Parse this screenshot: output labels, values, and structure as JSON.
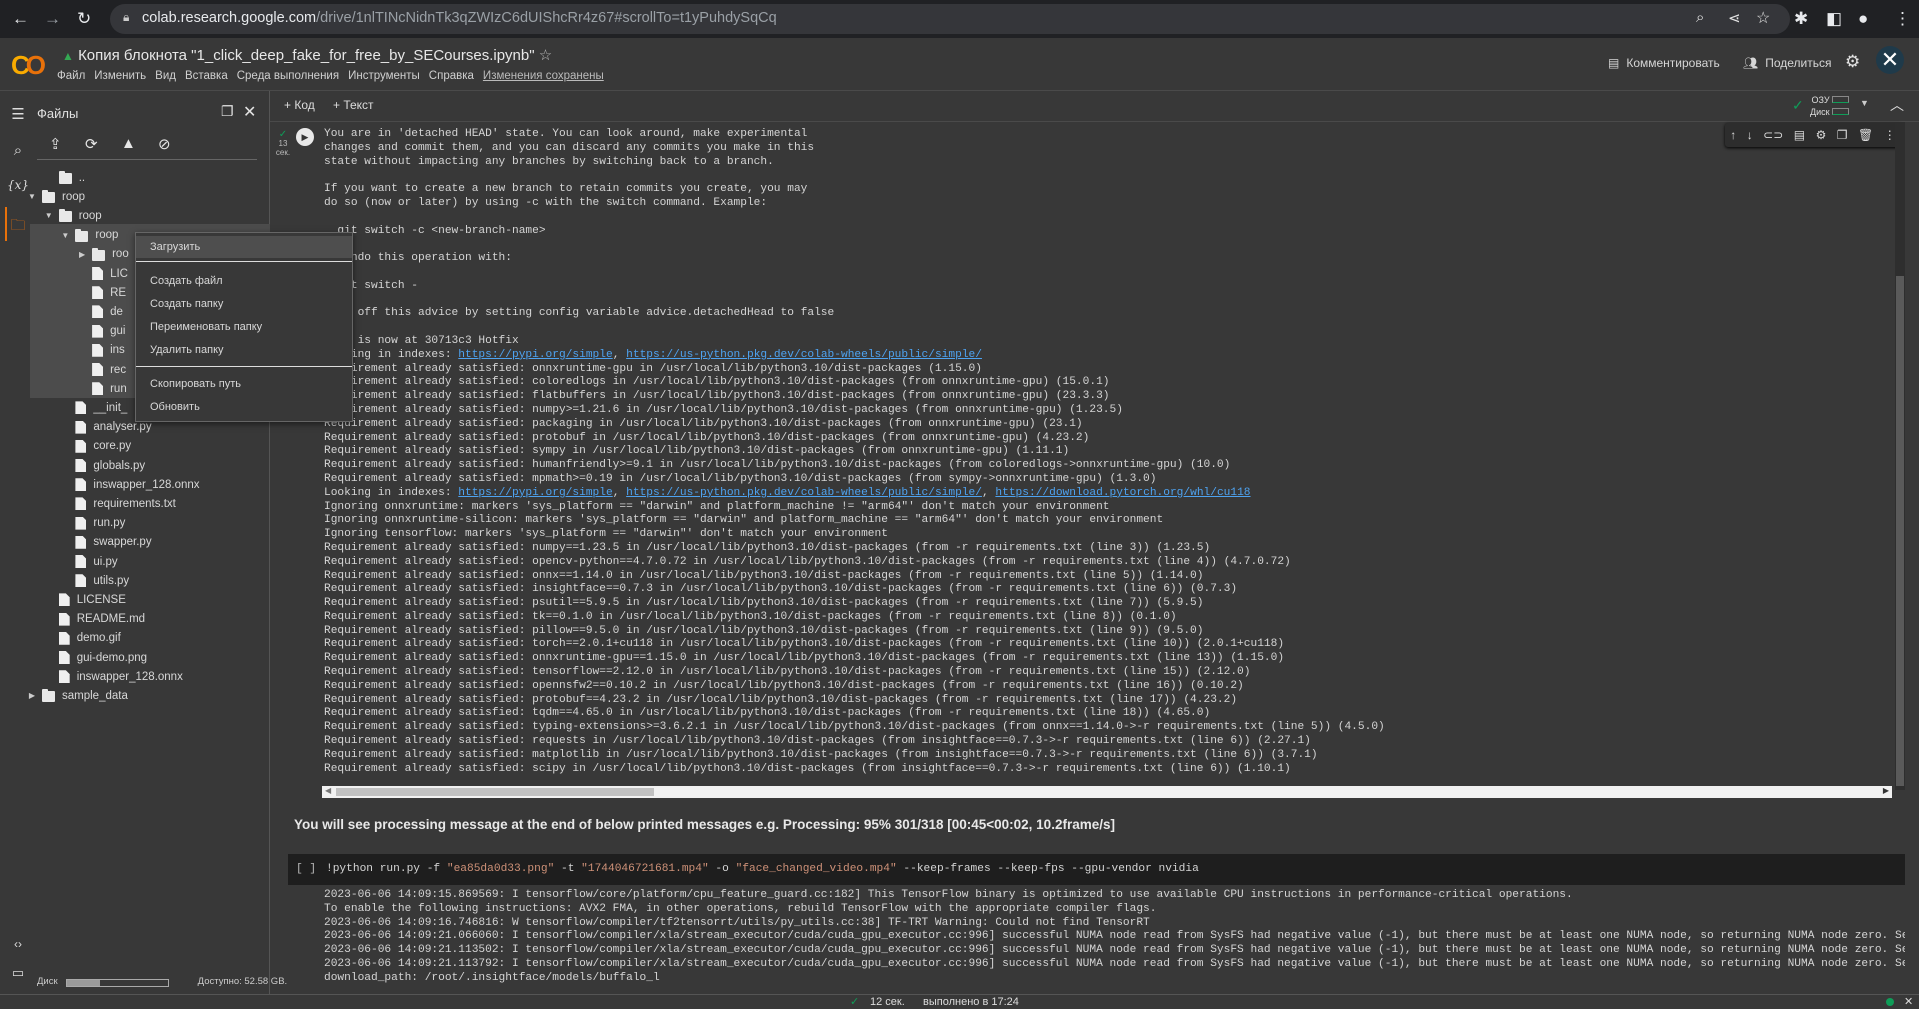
{
  "browser": {
    "url_host": "colab.research.google.com",
    "url_path": "/drive/1nlTINcNidnTk3qZWIzC6dUIShcRr4z67#scrollTo=t1yPuhdySqCq",
    "icons": [
      "back-icon",
      "forward-icon",
      "reload-icon",
      "lock-icon",
      "zoom-icon",
      "share-icon",
      "star-icon",
      "extensions-icon",
      "side-panel-icon",
      "profile-icon",
      "menu-icon"
    ]
  },
  "header": {
    "logo": "CO",
    "title": "Копия блокнота \"1_click_deep_fake_for_free_by_SECourses.ipynb\"",
    "menus": [
      "Файл",
      "Изменить",
      "Вид",
      "Вставка",
      "Среда выполнения",
      "Инструменты",
      "Справка"
    ],
    "saved_status": "Изменения сохранены",
    "comment_label": "Комментировать",
    "share_label": "Поделиться"
  },
  "toolbar": {
    "add_code": "+ Код",
    "add_text": "+ Текст",
    "ram_label": "ОЗУ",
    "disk_label": "Диск"
  },
  "files_panel": {
    "title": "Файлы",
    "tree": [
      {
        "name": "..",
        "level": 1,
        "type": "up"
      },
      {
        "name": "roop",
        "level": 0,
        "type": "folder",
        "expanded": true
      },
      {
        "name": "roop",
        "level": 1,
        "type": "folder",
        "expanded": true
      },
      {
        "name": "roop",
        "level": 2,
        "type": "folder",
        "expanded": true
      },
      {
        "name": "roo",
        "level": 3,
        "type": "folder",
        "expanded": false
      },
      {
        "name": "LIC",
        "level": 3,
        "type": "file"
      },
      {
        "name": "RE",
        "level": 3,
        "type": "file"
      },
      {
        "name": "de",
        "level": 3,
        "type": "file"
      },
      {
        "name": "gui",
        "level": 3,
        "type": "file"
      },
      {
        "name": "ins",
        "level": 3,
        "type": "file"
      },
      {
        "name": "rec",
        "level": 3,
        "type": "file"
      },
      {
        "name": "run",
        "level": 3,
        "type": "file"
      },
      {
        "name": "__init_",
        "level": 2,
        "type": "file"
      },
      {
        "name": "analyser.py",
        "level": 2,
        "type": "file"
      },
      {
        "name": "core.py",
        "level": 2,
        "type": "file"
      },
      {
        "name": "globals.py",
        "level": 2,
        "type": "file"
      },
      {
        "name": "inswapper_128.onnx",
        "level": 2,
        "type": "file"
      },
      {
        "name": "requirements.txt",
        "level": 2,
        "type": "file"
      },
      {
        "name": "run.py",
        "level": 2,
        "type": "file"
      },
      {
        "name": "swapper.py",
        "level": 2,
        "type": "file"
      },
      {
        "name": "ui.py",
        "level": 2,
        "type": "file"
      },
      {
        "name": "utils.py",
        "level": 2,
        "type": "file"
      },
      {
        "name": "LICENSE",
        "level": 1,
        "type": "file"
      },
      {
        "name": "README.md",
        "level": 1,
        "type": "file"
      },
      {
        "name": "demo.gif",
        "level": 1,
        "type": "file"
      },
      {
        "name": "gui-demo.png",
        "level": 1,
        "type": "file"
      },
      {
        "name": "inswapper_128.onnx",
        "level": 1,
        "type": "file"
      },
      {
        "name": "sample_data",
        "level": 0,
        "type": "folder",
        "expanded": false
      }
    ],
    "disk_label": "Диск",
    "disk_used_fraction": 0.33,
    "disk_available": "Доступно: 52.58 GB."
  },
  "context_menu": {
    "items": [
      "Загрузить",
      "Создать файл",
      "Создать папку",
      "Переименовать папку",
      "Удалить папку",
      "Скопировать путь",
      "Обновить"
    ]
  },
  "cell1": {
    "exec_time": "13",
    "exec_unit": "сек.",
    "output_lines": [
      "You are in 'detached HEAD' state. You can look around, make experimental",
      "changes and commit them, and you can discard any commits you make in this",
      "state without impacting any branches by switching back to a branch.",
      "",
      "If you want to create a new branch to retain commits you create, you may",
      "do so (now or later) by using -c with the switch command. Example:",
      "",
      "  git switch -c <new-branch-name>",
      "",
      "Or undo this operation with:",
      "",
      "  git switch -",
      "",
      "Turn off this advice by setting config variable advice.detachedHead to false",
      "",
      "HEAD is now at 30713c3 Hotfix",
      [
        {
          "text": "Looking in indexes: "
        },
        {
          "text": "https://pypi.org/simple",
          "link": true
        },
        {
          "text": ", "
        },
        {
          "text": "https://us-python.pkg.dev/colab-wheels/public/simple/",
          "link": true
        }
      ],
      "Requirement already satisfied: onnxruntime-gpu in /usr/local/lib/python3.10/dist-packages (1.15.0)",
      "Requirement already satisfied: coloredlogs in /usr/local/lib/python3.10/dist-packages (from onnxruntime-gpu) (15.0.1)",
      "Requirement already satisfied: flatbuffers in /usr/local/lib/python3.10/dist-packages (from onnxruntime-gpu) (23.3.3)",
      "Requirement already satisfied: numpy>=1.21.6 in /usr/local/lib/python3.10/dist-packages (from onnxruntime-gpu) (1.23.5)",
      "Requirement already satisfied: packaging in /usr/local/lib/python3.10/dist-packages (from onnxruntime-gpu) (23.1)",
      "Requirement already satisfied: protobuf in /usr/local/lib/python3.10/dist-packages (from onnxruntime-gpu) (4.23.2)",
      "Requirement already satisfied: sympy in /usr/local/lib/python3.10/dist-packages (from onnxruntime-gpu) (1.11.1)",
      "Requirement already satisfied: humanfriendly>=9.1 in /usr/local/lib/python3.10/dist-packages (from coloredlogs->onnxruntime-gpu) (10.0)",
      "Requirement already satisfied: mpmath>=0.19 in /usr/local/lib/python3.10/dist-packages (from sympy->onnxruntime-gpu) (1.3.0)",
      [
        {
          "text": "Looking in indexes: "
        },
        {
          "text": "https://pypi.org/simple",
          "link": true
        },
        {
          "text": ", "
        },
        {
          "text": "https://us-python.pkg.dev/colab-wheels/public/simple/",
          "link": true
        },
        {
          "text": ", "
        },
        {
          "text": "https://download.pytorch.org/whl/cu118",
          "link": true
        }
      ],
      "Ignoring onnxruntime: markers 'sys_platform == \"darwin\" and platform_machine != \"arm64\"' don't match your environment",
      "Ignoring onnxruntime-silicon: markers 'sys_platform == \"darwin\" and platform_machine == \"arm64\"' don't match your environment",
      "Ignoring tensorflow: markers 'sys_platform == \"darwin\"' don't match your environment",
      "Requirement already satisfied: numpy==1.23.5 in /usr/local/lib/python3.10/dist-packages (from -r requirements.txt (line 3)) (1.23.5)",
      "Requirement already satisfied: opencv-python==4.7.0.72 in /usr/local/lib/python3.10/dist-packages (from -r requirements.txt (line 4)) (4.7.0.72)",
      "Requirement already satisfied: onnx==1.14.0 in /usr/local/lib/python3.10/dist-packages (from -r requirements.txt (line 5)) (1.14.0)",
      "Requirement already satisfied: insightface==0.7.3 in /usr/local/lib/python3.10/dist-packages (from -r requirements.txt (line 6)) (0.7.3)",
      "Requirement already satisfied: psutil==5.9.5 in /usr/local/lib/python3.10/dist-packages (from -r requirements.txt (line 7)) (5.9.5)",
      "Requirement already satisfied: tk==0.1.0 in /usr/local/lib/python3.10/dist-packages (from -r requirements.txt (line 8)) (0.1.0)",
      "Requirement already satisfied: pillow==9.5.0 in /usr/local/lib/python3.10/dist-packages (from -r requirements.txt (line 9)) (9.5.0)",
      "Requirement already satisfied: torch==2.0.1+cu118 in /usr/local/lib/python3.10/dist-packages (from -r requirements.txt (line 10)) (2.0.1+cu118)",
      "Requirement already satisfied: onnxruntime-gpu==1.15.0 in /usr/local/lib/python3.10/dist-packages (from -r requirements.txt (line 13)) (1.15.0)",
      "Requirement already satisfied: tensorflow==2.12.0 in /usr/local/lib/python3.10/dist-packages (from -r requirements.txt (line 15)) (2.12.0)",
      "Requirement already satisfied: opennsfw2==0.10.2 in /usr/local/lib/python3.10/dist-packages (from -r requirements.txt (line 16)) (0.10.2)",
      "Requirement already satisfied: protobuf==4.23.2 in /usr/local/lib/python3.10/dist-packages (from -r requirements.txt (line 17)) (4.23.2)",
      "Requirement already satisfied: tqdm==4.65.0 in /usr/local/lib/python3.10/dist-packages (from -r requirements.txt (line 18)) (4.65.0)",
      "Requirement already satisfied: typing-extensions>=3.6.2.1 in /usr/local/lib/python3.10/dist-packages (from onnx==1.14.0->-r requirements.txt (line 5)) (4.5.0)",
      "Requirement already satisfied: requests in /usr/local/lib/python3.10/dist-packages (from insightface==0.7.3->-r requirements.txt (line 6)) (2.27.1)",
      "Requirement already satisfied: matplotlib in /usr/local/lib/python3.10/dist-packages (from insightface==0.7.3->-r requirements.txt (line 6)) (3.7.1)",
      "Requirement already satisfied: scipy in /usr/local/lib/python3.10/dist-packages (from insightface==0.7.3->-r requirements.txt (line 6)) (1.10.1)"
    ]
  },
  "text_cell": "You will see processing message at the end of below printed messages e.g. Processing: 95% 301/318 [00:45<00:02, 10.2frame/s]",
  "cell2": {
    "prompt": "[ ]",
    "code": [
      {
        "text": "!python run.py -f "
      },
      {
        "text": "\"ea85da0d33.png\"",
        "str": true
      },
      {
        "text": " -t "
      },
      {
        "text": "\"1744046721681.mp4\"",
        "str": true
      },
      {
        "text": " -o "
      },
      {
        "text": "\"face_changed_video.mp4\"",
        "str": true
      },
      {
        "text": " --keep-frames --keep-fps --gpu-vendor nvidia"
      }
    ],
    "output_lines": [
      "2023-06-06 14:09:15.869569: I tensorflow/core/platform/cpu_feature_guard.cc:182] This TensorFlow binary is optimized to use available CPU instructions in performance-critical operations.",
      "To enable the following instructions: AVX2 FMA, in other operations, rebuild TensorFlow with the appropriate compiler flags.",
      "2023-06-06 14:09:16.746816: W tensorflow/compiler/tf2tensorrt/utils/py_utils.cc:38] TF-TRT Warning: Could not find TensorRT",
      "2023-06-06 14:09:21.066060: I tensorflow/compiler/xla/stream_executor/cuda/cuda_gpu_executor.cc:996] successful NUMA node read from SysFS had negative value (-1), but there must be at least one NUMA node, so returning NUMA node zero. Se",
      "2023-06-06 14:09:21.113502: I tensorflow/compiler/xla/stream_executor/cuda/cuda_gpu_executor.cc:996] successful NUMA node read from SysFS had negative value (-1), but there must be at least one NUMA node, so returning NUMA node zero. Se",
      "2023-06-06 14:09:21.113792: I tensorflow/compiler/xla/stream_executor/cuda/cuda_gpu_executor.cc:996] successful NUMA node read from SysFS had negative value (-1), but there must be at least one NUMA node, so returning NUMA node zero. Se",
      "download_path: /root/.insightface/models/buffalo_l"
    ]
  },
  "status_bar": {
    "time": "12 сек.",
    "completed": "выполнено в 17:24"
  },
  "colors": {
    "accent": "#e8710a",
    "link": "#4ea3f1",
    "success": "#0f9d58",
    "string": "#ce9178"
  }
}
